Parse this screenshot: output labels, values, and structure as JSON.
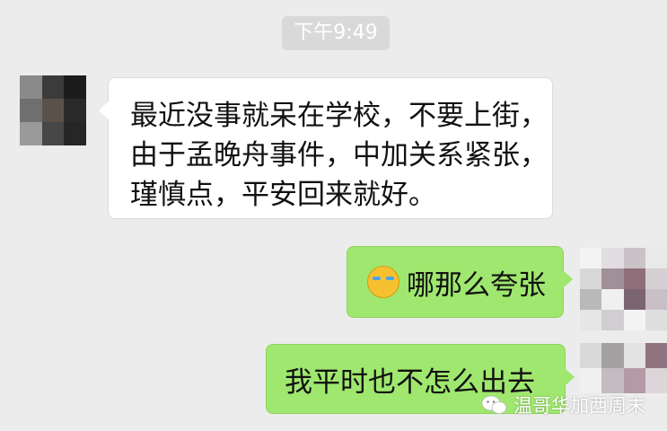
{
  "timestamp": "下午9:49",
  "messages": [
    {
      "side": "left",
      "text": "最近没事就呆在学校，不要上街，由于孟晚舟事件，中加关系紧张，瑾慎点，平安回来就好。"
    },
    {
      "side": "right",
      "emoji": "crying-laughing-emoji",
      "text": "哪那么夸张"
    },
    {
      "side": "right",
      "text": "我平时也不怎么出去"
    }
  ],
  "watermark": {
    "text": "温哥华加西周末",
    "icon": "wechat-icon"
  },
  "colors": {
    "background": "#ececec",
    "incoming_bubble": "#ffffff",
    "outgoing_bubble": "#9fe76e",
    "timestamp_bg": "#d9d9d9"
  }
}
